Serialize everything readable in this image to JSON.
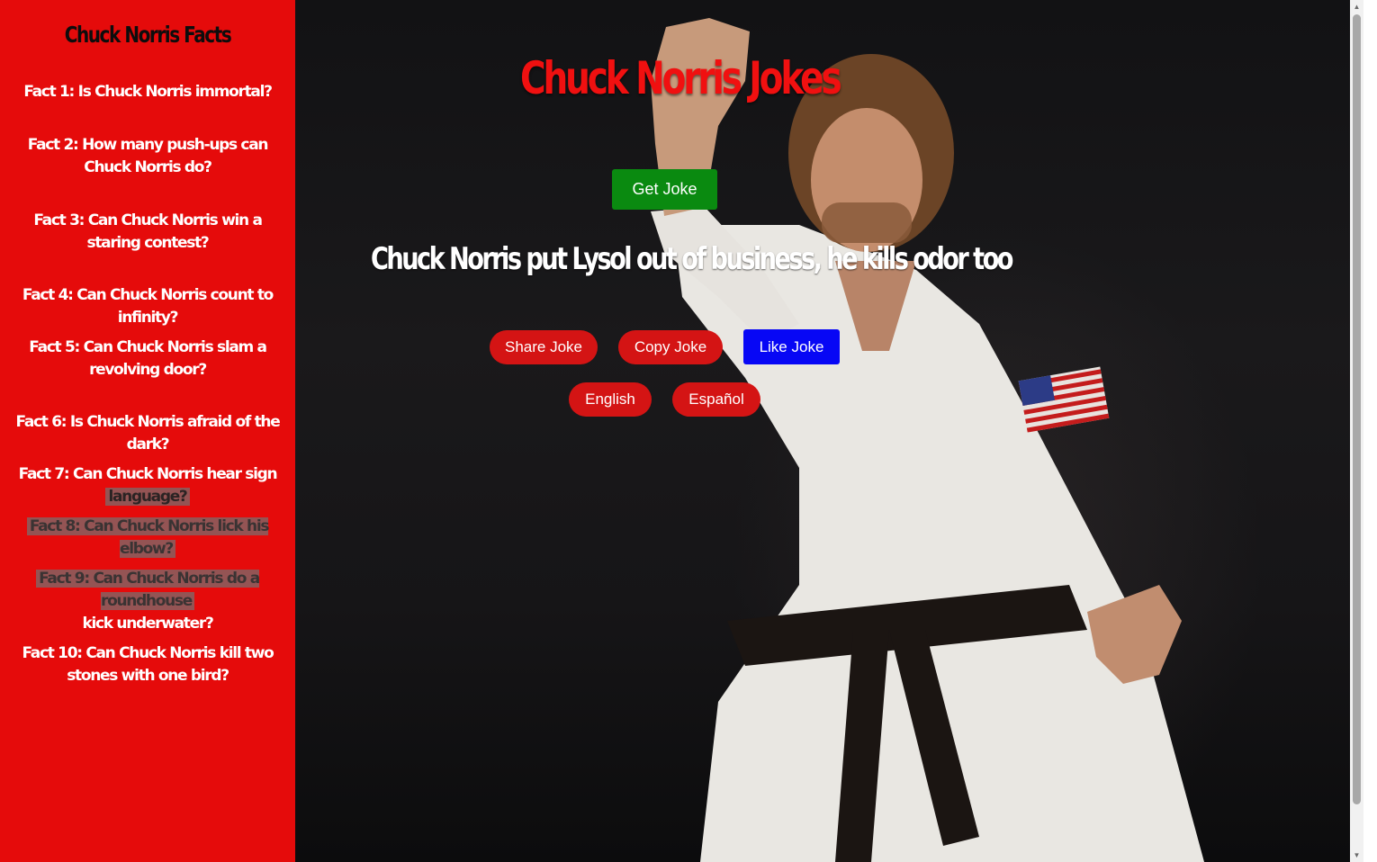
{
  "sidebar": {
    "title": "Chuck Norris Facts",
    "facts": [
      {
        "label": "Fact 1: Is Chuck Norris immortal?"
      },
      {
        "label": "Fact 2: How many push-ups can Chuck Norris do?"
      },
      {
        "label": "Fact 3: Can Chuck Norris win a staring contest?"
      },
      {
        "label": "Fact 4: Can Chuck Norris count to infinity?"
      },
      {
        "label": "Fact 5: Can Chuck Norris slam a revolving door?"
      },
      {
        "label": "Fact 6: Is Chuck Norris afraid of the dark?"
      },
      {
        "label_a": "Fact 7: Can Chuck Norris hear sign",
        "label_b": "language?"
      },
      {
        "label": "Fact 8: Can Chuck Norris lick his elbow?"
      },
      {
        "label_a": "Fact 9: Can Chuck Norris do a roundhouse",
        "label_b": "kick underwater?"
      },
      {
        "label": "Fact 10: Can Chuck Norris kill two stones with one bird?"
      }
    ]
  },
  "main": {
    "title": "Chuck Norris Jokes",
    "get_joke_label": "Get Joke",
    "joke": "Chuck Norris put Lysol out of business, he kills odor too",
    "actions": {
      "share": "Share Joke",
      "copy": "Copy Joke",
      "like": "Like Joke"
    },
    "languages": {
      "english": "English",
      "spanish": "Español"
    }
  },
  "colors": {
    "sidebar_bg": "#e50b0b",
    "title_red": "#f01010",
    "get_joke_green": "#0a8a10",
    "pill_red": "#d41414",
    "like_blue": "#0707f5"
  }
}
